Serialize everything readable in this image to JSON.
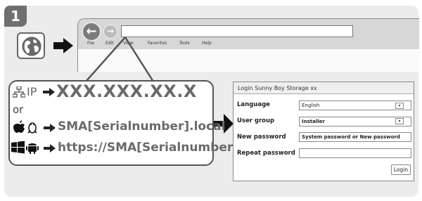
{
  "step": {
    "number": "1"
  },
  "browser": {
    "menu": [
      "File",
      "Edit",
      "View",
      "Favorites",
      "Tools",
      "Help"
    ],
    "back_icon": "arrow-left-icon",
    "forward_icon": "arrow-right-icon"
  },
  "access": {
    "ip_label": "IP",
    "ip_value": "XXX.XXX.XX.X",
    "or_label": "or",
    "local_value": "SMA[Serialnumber].local",
    "https_value": "https://SMA[Serialnumber]"
  },
  "login": {
    "title": "Login Sunny Boy Storage xx",
    "language_label": "Language",
    "language_value": "English",
    "group_label": "User group",
    "group_value": "Installer",
    "new_password_label": "New password",
    "new_password_value": "System password or New password",
    "repeat_password_label": "Repeat password",
    "repeat_password_value": "",
    "login_button": "Login"
  },
  "colors": {
    "panel": "#ececec",
    "arrow": "#111111",
    "text_grey": "#6a6a6a"
  }
}
